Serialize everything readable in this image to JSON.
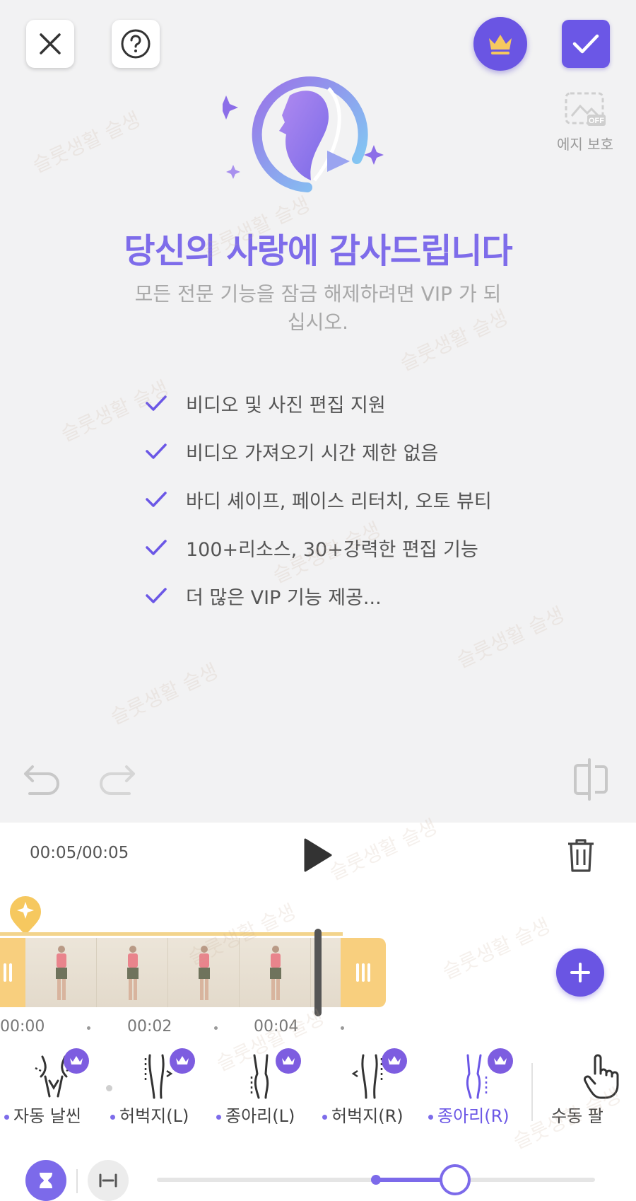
{
  "promo": {
    "title": "당신의 사랑에 감사드립니다",
    "subtitle": "모든 전문 기능을 잠금 해제하려면 VIP 가 되십시오.",
    "features": [
      "비디오 및 사진 편집 지원",
      "비디오 가져오기 시간 제한 없음",
      "바디 셰이프, 페이스 리터치, 오토 뷰티",
      "100+리소스, 30+강력한 편집 기능",
      "더 많은 VIP 기능 제공..."
    ]
  },
  "header": {
    "edge_protect_label": "에지 보호",
    "edge_protect_state": "OFF"
  },
  "playback": {
    "time": "00:05/00:05"
  },
  "timeline": {
    "ticks": [
      "00:00",
      "00:02",
      "00:04"
    ],
    "frame_count": 5
  },
  "tools": [
    {
      "label": "자동 날씬",
      "icon": "waist-slim-icon",
      "vip": true
    },
    {
      "label": "허벅지(L)",
      "icon": "thigh-left-icon",
      "vip": true
    },
    {
      "label": "종아리(L)",
      "icon": "calf-left-icon",
      "vip": true
    },
    {
      "label": "허벅지(R)",
      "icon": "thigh-right-icon",
      "vip": true
    },
    {
      "label": "종아리(R)",
      "icon": "calf-right-icon",
      "vip": true,
      "active": true
    },
    {
      "label": "수동 팔",
      "icon": "hand-pointer-icon",
      "vip": false
    }
  ],
  "slider": {
    "value": 0.68
  },
  "watermark": "슬룻생활 슬생",
  "colors": {
    "accent": "#6b57e6",
    "accent_light": "#7e6cea",
    "strip": "#f8cf7e"
  }
}
